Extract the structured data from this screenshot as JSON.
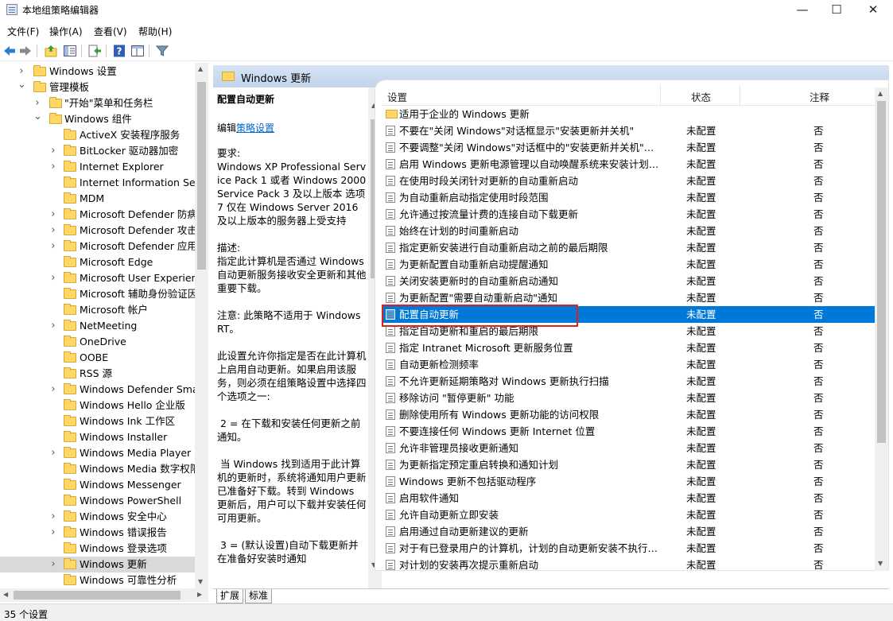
{
  "window": {
    "title": "本地组策略编辑器",
    "minimize": "—",
    "maximize": "☐",
    "close": "✕"
  },
  "menu": [
    "文件(F)",
    "操作(A)",
    "查看(V)",
    "帮助(H)"
  ],
  "toolbar_icons": [
    "back-arrow-icon",
    "forward-arrow-icon",
    "up-folder-icon",
    "show-hide-tree-icon",
    "export-list-icon",
    "help-icon",
    "extended-view-icon",
    "filter-icon"
  ],
  "tree": [
    {
      "label": "Windows 设置",
      "level": 1,
      "expander": "collapsed"
    },
    {
      "label": "管理模板",
      "level": 1,
      "expander": "expanded"
    },
    {
      "label": "\"开始\"菜单和任务栏",
      "level": 2,
      "expander": "collapsed"
    },
    {
      "label": "Windows 组件",
      "level": 2,
      "expander": "expanded"
    },
    {
      "label": "ActiveX 安装程序服务",
      "level": 3,
      "expander": "none"
    },
    {
      "label": "BitLocker 驱动器加密",
      "level": 3,
      "expander": "collapsed"
    },
    {
      "label": "Internet Explorer",
      "level": 3,
      "expander": "collapsed"
    },
    {
      "label": "Internet Information Serv",
      "level": 3,
      "expander": "none"
    },
    {
      "label": "MDM",
      "level": 3,
      "expander": "none"
    },
    {
      "label": "Microsoft Defender 防病",
      "level": 3,
      "expander": "collapsed"
    },
    {
      "label": "Microsoft Defender 攻击",
      "level": 3,
      "expander": "collapsed"
    },
    {
      "label": "Microsoft Defender 应用",
      "level": 3,
      "expander": "collapsed"
    },
    {
      "label": "Microsoft Edge",
      "level": 3,
      "expander": "none"
    },
    {
      "label": "Microsoft User Experienc",
      "level": 3,
      "expander": "collapsed"
    },
    {
      "label": "Microsoft 辅助身份验证因",
      "level": 3,
      "expander": "none"
    },
    {
      "label": "Microsoft 帐户",
      "level": 3,
      "expander": "none"
    },
    {
      "label": "NetMeeting",
      "level": 3,
      "expander": "collapsed"
    },
    {
      "label": "OneDrive",
      "level": 3,
      "expander": "none"
    },
    {
      "label": "OOBE",
      "level": 3,
      "expander": "none"
    },
    {
      "label": "RSS 源",
      "level": 3,
      "expander": "none"
    },
    {
      "label": "Windows Defender Smar",
      "level": 3,
      "expander": "collapsed"
    },
    {
      "label": "Windows Hello 企业版",
      "level": 3,
      "expander": "none"
    },
    {
      "label": "Windows Ink 工作区",
      "level": 3,
      "expander": "none"
    },
    {
      "label": "Windows Installer",
      "level": 3,
      "expander": "none"
    },
    {
      "label": "Windows Media Player",
      "level": 3,
      "expander": "collapsed"
    },
    {
      "label": "Windows Media 数字权限",
      "level": 3,
      "expander": "none"
    },
    {
      "label": "Windows Messenger",
      "level": 3,
      "expander": "none"
    },
    {
      "label": "Windows PowerShell",
      "level": 3,
      "expander": "none"
    },
    {
      "label": "Windows 安全中心",
      "level": 3,
      "expander": "collapsed"
    },
    {
      "label": "Windows 错误报告",
      "level": 3,
      "expander": "collapsed"
    },
    {
      "label": "Windows 登录选项",
      "level": 3,
      "expander": "none"
    },
    {
      "label": "Windows 更新",
      "level": 3,
      "expander": "collapsed",
      "selected": true
    },
    {
      "label": "Windows 可靠性分析",
      "level": 3,
      "expander": "none"
    }
  ],
  "header": {
    "title": "Windows 更新"
  },
  "description": {
    "policy_title": "配置自动更新",
    "edit_prefix": "编辑",
    "edit_link": "策略设置",
    "body": "要求:\nWindows XP Professional Service Pack 1 或者 Windows 2000 Service Pack 3 及以上版本 选项 7 仅在 Windows Server 2016 及以上版本的服务器上受支持\n\n描述:\n指定此计算机是否通过 Windows 自动更新服务接收安全更新和其他重要下载。\n\n注意: 此策略不适用于 Windows RT。\n\n此设置允许你指定是否在此计算机上启用自动更新。如果启用该服务，则必须在组策略设置中选择四个选项之一:\n\n 2 = 在下载和安装任何更新之前通知。\n\n 当 Windows 找到适用于此计算机的更新时，系统将通知用户更新已准备好下载。转到 Windows 更新后，用户可以下载并安装任何可用更新。\n\n 3 = (默认设置)自动下载更新并在准备好安装时通知"
  },
  "columns": {
    "setting": "设置",
    "state": "状态",
    "note": "注释"
  },
  "settings": [
    {
      "name": "适用于企业的 Windows 更新",
      "state": "",
      "note": "",
      "folder": true
    },
    {
      "name": "不要在\"关闭 Windows\"对话框显示\"安装更新并关机\"",
      "state": "未配置",
      "note": "否"
    },
    {
      "name": "不要调整\"关闭 Windows\"对话框中的\"安装更新并关机\"的默...",
      "state": "未配置",
      "note": "否"
    },
    {
      "name": "启用 Windows 更新电源管理以自动唤醒系统来安装计划的...",
      "state": "未配置",
      "note": "否"
    },
    {
      "name": "在使用时段关闭针对更新的自动重新启动",
      "state": "未配置",
      "note": "否"
    },
    {
      "name": "为自动重新启动指定使用时段范围",
      "state": "未配置",
      "note": "否"
    },
    {
      "name": "允许通过按流量计费的连接自动下载更新",
      "state": "未配置",
      "note": "否"
    },
    {
      "name": "始终在计划的时间重新启动",
      "state": "未配置",
      "note": "否"
    },
    {
      "name": "指定更新安装进行自动重新启动之前的最后期限",
      "state": "未配置",
      "note": "否"
    },
    {
      "name": "为更新配置自动重新启动提醒通知",
      "state": "未配置",
      "note": "否"
    },
    {
      "name": "关闭安装更新时的自动重新启动通知",
      "state": "未配置",
      "note": "否"
    },
    {
      "name": "为更新配置\"需要自动重新启动\"通知",
      "state": "未配置",
      "note": "否"
    },
    {
      "name": "配置自动更新",
      "state": "未配置",
      "note": "否",
      "selected": true
    },
    {
      "name": "指定自动更新和重启的最后期限",
      "state": "未配置",
      "note": "否"
    },
    {
      "name": "指定 Intranet Microsoft 更新服务位置",
      "state": "未配置",
      "note": "否"
    },
    {
      "name": "自动更新检测频率",
      "state": "未配置",
      "note": "否"
    },
    {
      "name": "不允许更新延期策略对 Windows 更新执行扫描",
      "state": "未配置",
      "note": "否"
    },
    {
      "name": "移除访问 \"暂停更新\" 功能",
      "state": "未配置",
      "note": "否"
    },
    {
      "name": "删除使用所有 Windows 更新功能的访问权限",
      "state": "未配置",
      "note": "否"
    },
    {
      "name": "不要连接任何 Windows 更新 Internet 位置",
      "state": "未配置",
      "note": "否"
    },
    {
      "name": "允许非管理员接收更新通知",
      "state": "未配置",
      "note": "否"
    },
    {
      "name": "为更新指定预定重启转换和通知计划",
      "state": "未配置",
      "note": "否"
    },
    {
      "name": "Windows 更新不包括驱动程序",
      "state": "未配置",
      "note": "否"
    },
    {
      "name": "启用软件通知",
      "state": "未配置",
      "note": "否"
    },
    {
      "name": "允许自动更新立即安装",
      "state": "未配置",
      "note": "否"
    },
    {
      "name": "启用通过自动更新建议的更新",
      "state": "未配置",
      "note": "否"
    },
    {
      "name": "对于有已登录用户的计算机，计划的自动更新安装不执行重...",
      "state": "未配置",
      "note": "否"
    },
    {
      "name": "对计划的安装再次提示重新启动",
      "state": "未配置",
      "note": "否"
    }
  ],
  "tabs": [
    "扩展",
    "标准"
  ],
  "status": {
    "text": "35 个设置"
  },
  "colors": {
    "selection": "#0078d7",
    "highlight_box": "#e0201b",
    "header_band": "#c9daef",
    "link": "#0066cc"
  }
}
